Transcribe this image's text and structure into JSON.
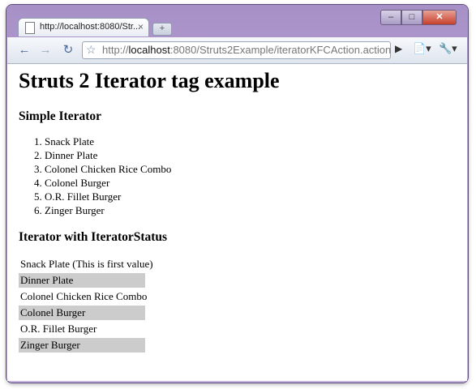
{
  "browser": {
    "tab_title": "http://localhost:8080/Str...",
    "tab_close": "×",
    "new_tab": "+",
    "url_prefix": "http://",
    "url_host": "localhost",
    "url_path": ":8080/Struts2Example/iteratorKFCAction.action",
    "window_buttons": {
      "minimize": "–",
      "maximize": "□",
      "close": "✕"
    }
  },
  "page": {
    "heading": "Struts 2 Iterator tag example",
    "simple_iterator": {
      "heading": "Simple Iterator",
      "items": [
        "Snack Plate",
        "Dinner Plate",
        "Colonel Chicken Rice Combo",
        "Colonel Burger",
        "O.R. Fillet Burger",
        "Zinger Burger"
      ]
    },
    "status_iterator": {
      "heading": "Iterator with IteratorStatus",
      "items": [
        "Snack Plate (This is first value)",
        "Dinner Plate",
        "Colonel Chicken Rice Combo",
        "Colonel Burger",
        "O.R. Fillet Burger",
        "Zinger Burger"
      ]
    }
  },
  "colors": {
    "odd_row": "#cccccc",
    "frame": "#b8a3d6"
  }
}
